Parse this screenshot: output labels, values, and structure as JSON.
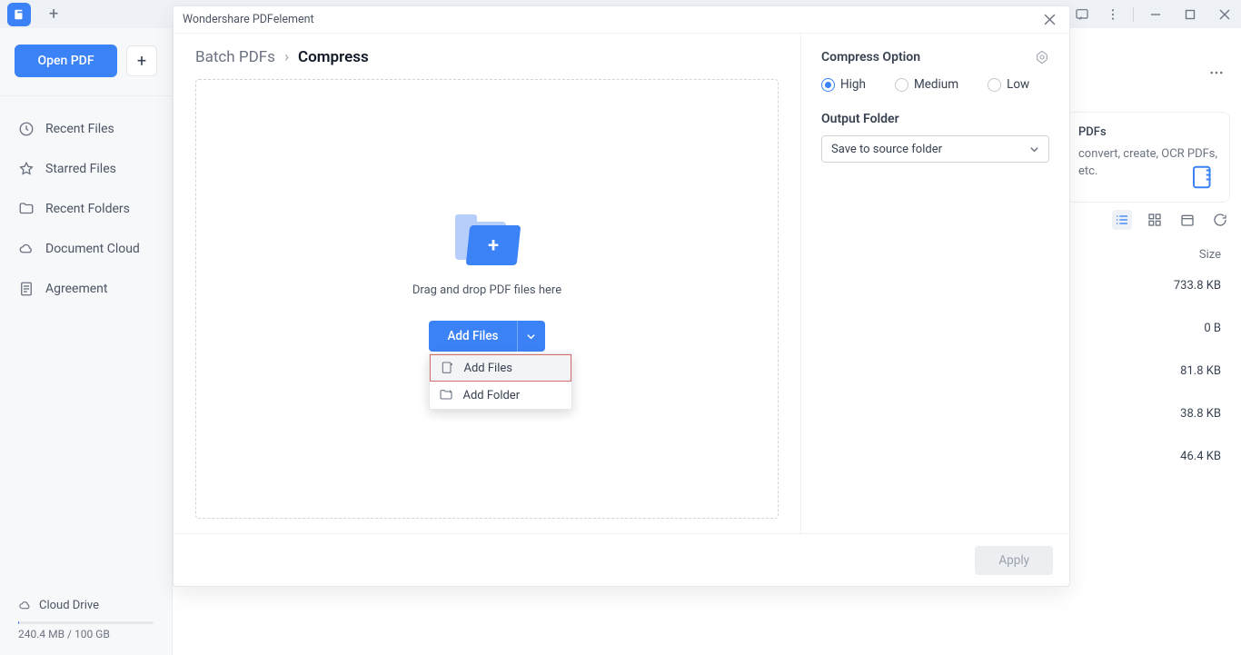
{
  "titlebar": {
    "app_name": "PDFelement"
  },
  "sidebar": {
    "open_label": "Open PDF",
    "nav": [
      {
        "label": "Recent Files"
      },
      {
        "label": "Starred Files"
      },
      {
        "label": "Recent Folders"
      },
      {
        "label": "Document Cloud"
      },
      {
        "label": "Agreement"
      }
    ],
    "cloud_label": "Cloud Drive",
    "storage_text": "240.4 MB / 100 GB"
  },
  "content": {
    "card_title": "PDFs",
    "card_desc": "convert, create, OCR PDFs, etc.",
    "size_header": "Size",
    "sizes": [
      "733.8 KB",
      "0 B",
      "81.8 KB",
      "38.8 KB",
      "46.4 KB"
    ]
  },
  "modal": {
    "title": "Wondershare PDFelement",
    "breadcrumb": {
      "first": "Batch PDFs",
      "second": "Compress"
    },
    "dropzone_text": "Drag and drop PDF files here",
    "add_files_btn": "Add Files",
    "dd": [
      {
        "label": "Add Files"
      },
      {
        "label": "Add Folder"
      }
    ],
    "option_header": "Compress Option",
    "radios": [
      {
        "label": "High",
        "checked": true
      },
      {
        "label": "Medium",
        "checked": false
      },
      {
        "label": "Low",
        "checked": false
      }
    ],
    "output_label": "Output Folder",
    "output_value": "Save to source folder",
    "apply_label": "Apply"
  }
}
